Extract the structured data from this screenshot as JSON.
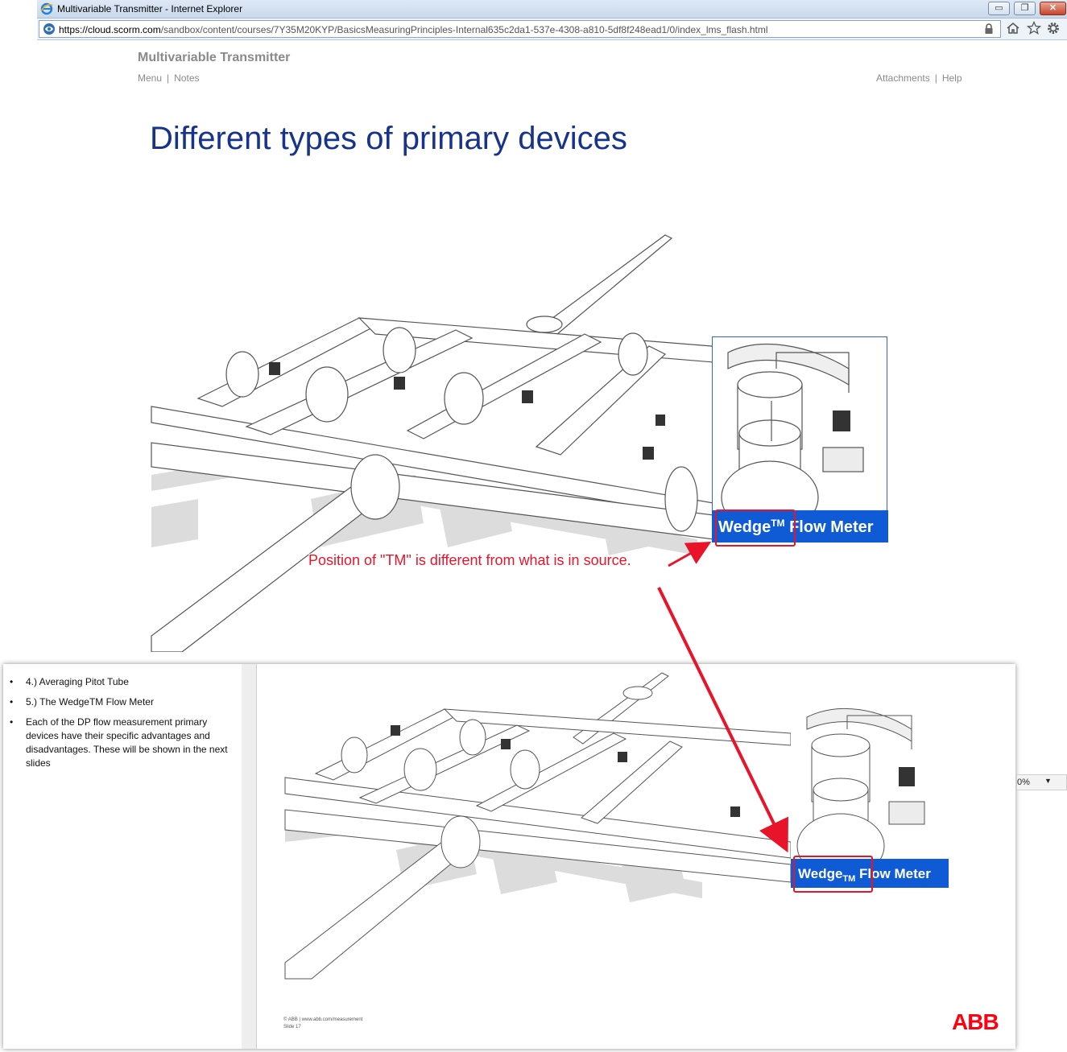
{
  "window": {
    "title": "Multivariable Transmitter - Internet Explorer",
    "url_prefix": "https://cloud.",
    "url_domain": "scorm.com",
    "url_rest": "/sandbox/content/courses/7Y35M20KYP/BasicsMeasuringPrinciples-Internal635c2da1-537e-4308-a810-5df8f248ead1/0/index_lms_flash.html",
    "buttons": {
      "minimize": "▭",
      "restore": "❐",
      "close": "✕"
    }
  },
  "course": {
    "title": "Multivariable Transmitter",
    "nav_left": [
      "Menu",
      "Notes"
    ],
    "nav_right": [
      "Attachments",
      "Help"
    ],
    "separator": "|"
  },
  "slide": {
    "title": "Different types of primary devices",
    "banner_top": {
      "word": "Wedge",
      "mark": "TM",
      "rest": " Flow Meter"
    },
    "banner_bottom": {
      "word": "Wedge",
      "mark": "TM",
      "rest": " Flow Meter"
    }
  },
  "annotation": {
    "callout": "Position of \"TM\" is different from what is in source.",
    "color": "#e8142a"
  },
  "notes": {
    "items": [
      "4.) Averaging Pitot Tube",
      "5.) The WedgeTM Flow Meter",
      "Each of the DP flow measurement primary devices have their specific advantages and disadvantages. These will be shown in the next slides"
    ]
  },
  "lower_slide": {
    "footer_line1": "© ABB  | www.abb.com/measurement",
    "footer_line2": "Slide 17",
    "logo": "ABB",
    "zoom_value": "0%"
  },
  "colors": {
    "title_blue": "#17338c",
    "banner_blue": "#0f5bd6",
    "abb_red": "#ff000f"
  }
}
